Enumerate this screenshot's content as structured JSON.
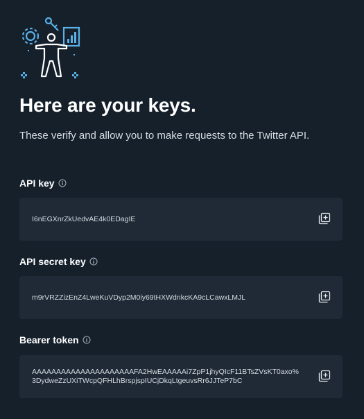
{
  "heading": {
    "title": "Here are your keys.",
    "subtitle": "These verify and allow you to make requests to the Twitter API."
  },
  "keys": [
    {
      "label": "API key",
      "value": "I6nEGXnrZkUedvAE4k0EDagIE"
    },
    {
      "label": "API secret key",
      "value": "m9rVRZZizEnZ4LweKuVDyp2M0iy69tHXWdnkcKA9cLCawxLMJL"
    },
    {
      "label": "Bearer token",
      "value_line1": "AAAAAAAAAAAAAAAAAAAAAFA2HwEAAAAAi7ZpP1jhyQIcF11BTsZVsKT0axo%",
      "value_line2": "3DydweZzUXiTWcpQFHLhBrspjspIUCjDkqLtgeuvsRr6JJTeP7bC"
    }
  ],
  "icons": {
    "illustration": "developer-gear-key-chart-illustration",
    "info": "info-circle-icon",
    "copy": "copy-icon"
  },
  "colors": {
    "background": "#15202b",
    "box": "#1f2a36",
    "accent": "#4aa3df"
  }
}
